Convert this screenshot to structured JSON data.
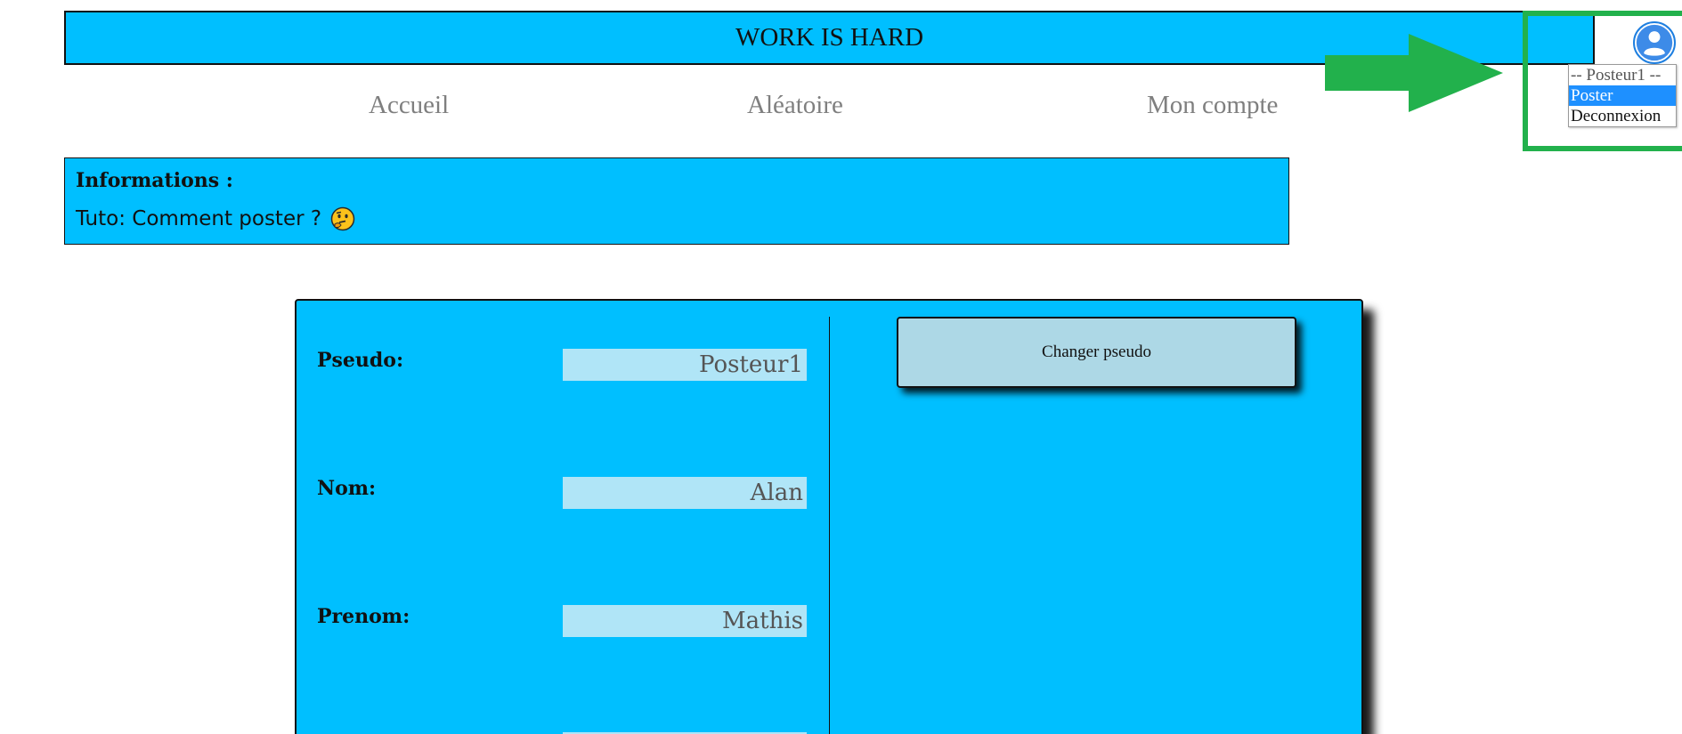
{
  "header": {
    "title": "WORK IS HARD"
  },
  "nav": {
    "home": "Accueil",
    "random": "Aléatoire",
    "account": "Mon compte"
  },
  "user_menu": {
    "icon": "user-avatar-icon",
    "options": [
      "-- Posteur1 --",
      "Poster",
      "Deconnexion"
    ],
    "selected": "Poster"
  },
  "info": {
    "title": "Informations :",
    "text": "Tuto: Comment poster ?",
    "emoji": "thinking-face"
  },
  "account_form": {
    "fields": [
      {
        "label": "Pseudo:",
        "value": "Posteur1"
      },
      {
        "label": "Nom:",
        "value": "Alan"
      },
      {
        "label": "Prenom:",
        "value": "Mathis"
      },
      {
        "label": "",
        "value": ""
      }
    ],
    "change_pseudo_button": "Changer pseudo"
  },
  "colors": {
    "primary": "#00bfff",
    "input_bg": "#b0e5f7",
    "button_bg": "#add8e6",
    "highlight": "#22b14c",
    "selected_option": "#1e90ff"
  }
}
